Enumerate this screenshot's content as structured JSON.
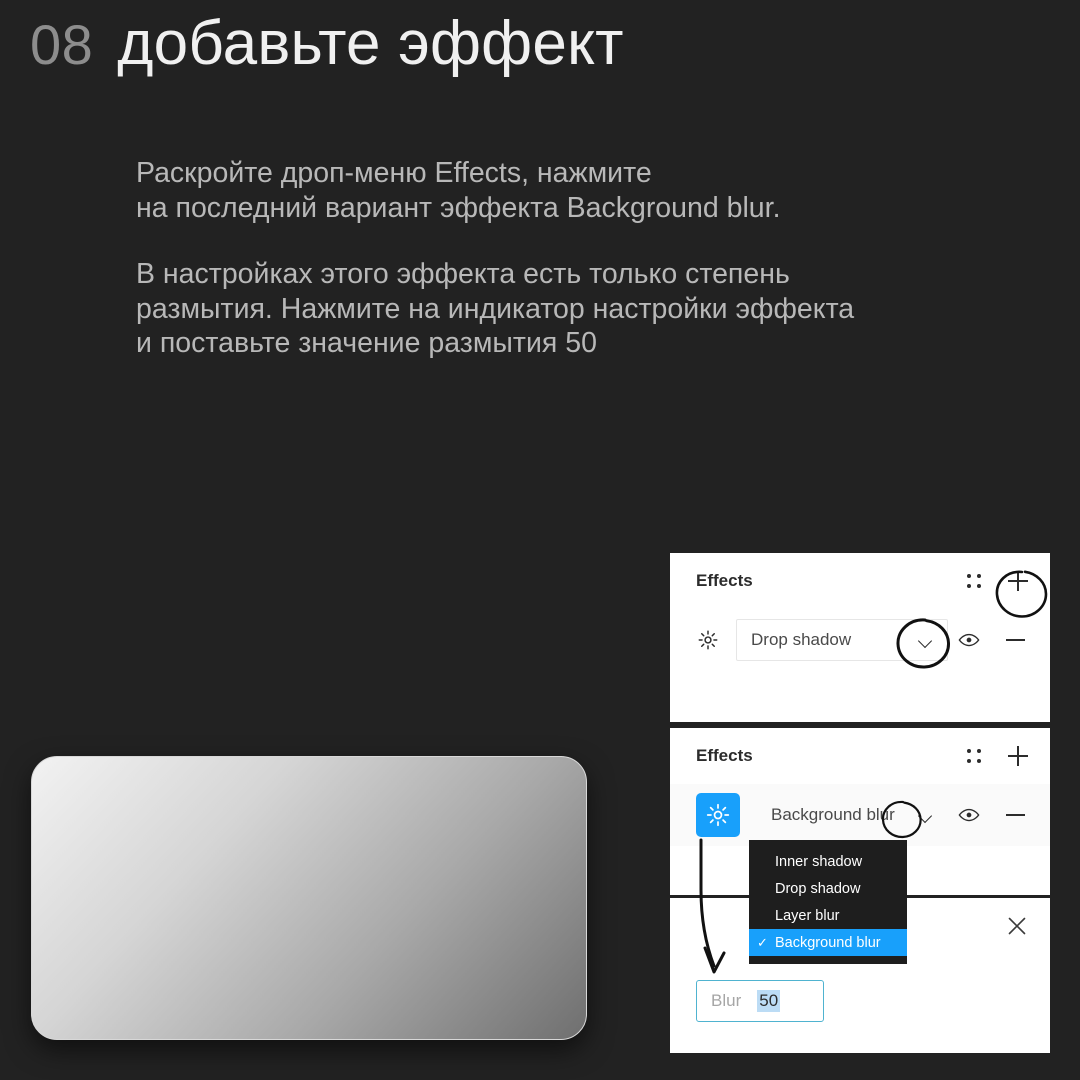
{
  "slide": {
    "number": "08",
    "heading": "добавьте эффект",
    "paragraphs": [
      "Раскройте дроп-меню Effects, нажмите\nна последний вариант эффекта Background blur.",
      "В настройках этого эффекта есть только степень\nразмытия. Нажмите на индикатор настройки эффекта\nи поставьте значение размытия 50"
    ]
  },
  "colors": {
    "background": "#222222",
    "accent_blue": "#18a0fb",
    "focus_border": "#4fb3d0",
    "selection_highlight": "#bcdcf5",
    "heading": "#f0f0f0",
    "number": "#8d8d8d",
    "body_text": "#b8b8b8",
    "panel_background": "#ffffff",
    "dropdown_background": "#1e1e1e"
  },
  "panels": [
    {
      "id": "effects-1",
      "header": {
        "title": "Effects",
        "icons": [
          "grid-dots-icon",
          "plus-icon"
        ]
      },
      "row": {
        "swatch_icon": "effect-sun-icon",
        "swatch_active": false,
        "label": "Drop shadow",
        "chevron_icon": "chevron-down-icon",
        "visibility_icon": "eye-icon",
        "remove_icon": "minus-icon"
      }
    },
    {
      "id": "effects-2",
      "header": {
        "title": "Effects",
        "icons": [
          "grid-dots-icon",
          "plus-icon"
        ]
      },
      "row": {
        "swatch_icon": "effect-sun-icon",
        "swatch_active": true,
        "label": "Background blur",
        "chevron_icon": "chevron-down-icon",
        "visibility_icon": "eye-icon",
        "remove_icon": "minus-icon"
      }
    }
  ],
  "dropdown": {
    "items": [
      {
        "label": "Inner shadow",
        "selected": false
      },
      {
        "label": "Drop shadow",
        "selected": false
      },
      {
        "label": "Layer blur",
        "selected": false
      },
      {
        "label": "Background blur",
        "selected": true
      }
    ],
    "check_glyph": "✓"
  },
  "blur_panel": {
    "close_icon": "close-x-icon",
    "input": {
      "label": "Blur",
      "value": "50"
    }
  },
  "annotations": {
    "circle_plus": "hand-drawn circle around plus button",
    "circle_chevron_1": "hand-drawn circle around drop shadow chevron",
    "circle_chevron_2": "hand-drawn circle around background blur chevron",
    "arrow": "hand-drawn curved arrow to blur input"
  },
  "shape": {
    "name": "gradient-rounded-rectangle"
  }
}
